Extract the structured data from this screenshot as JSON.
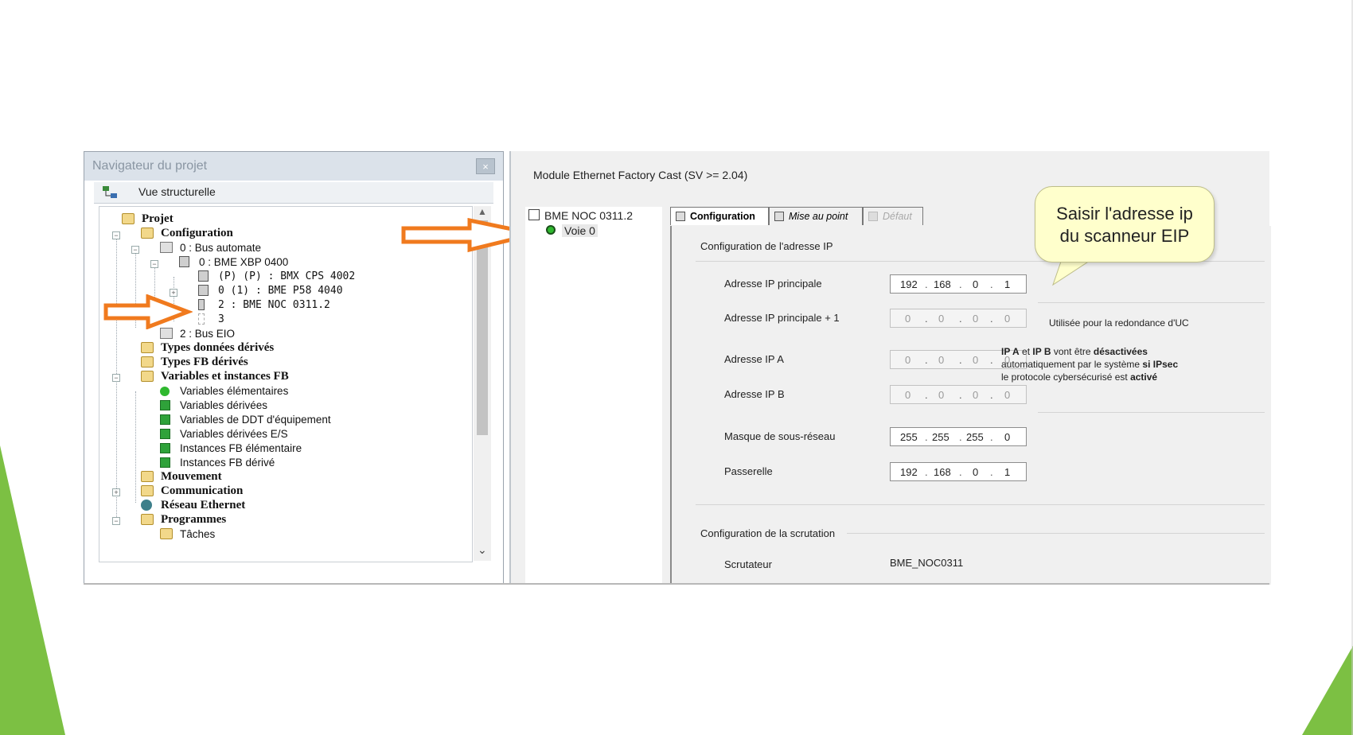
{
  "colors": {
    "arrow": "#f07a1e",
    "accent_green": "#7cc043",
    "callout_bg": "#ffffcc"
  },
  "navigator": {
    "title": "Navigateur du projet",
    "view_label": "Vue structurelle",
    "tree": [
      {
        "label": "Projet"
      },
      {
        "label": "Configuration"
      },
      {
        "label": "0 : Bus automate"
      },
      {
        "label": "0 : BME XBP 0400"
      },
      {
        "label": "(P) (P) : BMX CPS 4002"
      },
      {
        "label": "0 (1) : BME P58 4040"
      },
      {
        "label": "2 : BME NOC 0311.2"
      },
      {
        "label": "3"
      },
      {
        "label": "2 : Bus EIO"
      },
      {
        "label": "Types données dérivés"
      },
      {
        "label": "Types FB dérivés"
      },
      {
        "label": "Variables et instances FB"
      },
      {
        "label": "Variables élémentaires"
      },
      {
        "label": "Variables dérivées"
      },
      {
        "label": "Variables de DDT d'équipement"
      },
      {
        "label": "Variables dérivées E/S"
      },
      {
        "label": "Instances FB élémentaire"
      },
      {
        "label": "Instances FB dérivé"
      },
      {
        "label": "Mouvement"
      },
      {
        "label": "Communication"
      },
      {
        "label": "Réseau Ethernet"
      },
      {
        "label": "Programmes"
      },
      {
        "label": "Tâches"
      }
    ]
  },
  "module": {
    "title": "Module Ethernet Factory Cast (SV >= 2.04)",
    "device": "BME NOC 0311.2",
    "channel": "Voie 0",
    "tabs": [
      {
        "label": "Configuration"
      },
      {
        "label": "Mise au point"
      },
      {
        "label": "Défaut"
      }
    ],
    "ip_section": "Configuration de l'adresse IP",
    "fields": [
      {
        "label": "Adresse IP principale",
        "octets": [
          "192",
          "168",
          "0",
          "1"
        ]
      },
      {
        "label": "Adresse IP principale + 1",
        "octets": [
          "0",
          "0",
          "0",
          "0"
        ]
      },
      {
        "label": "Adresse IP A",
        "octets": [
          "0",
          "0",
          "0",
          "0"
        ]
      },
      {
        "label": "Adresse IP B",
        "octets": [
          "0",
          "0",
          "0",
          "0"
        ]
      },
      {
        "label": "Masque de sous-réseau",
        "octets": [
          "255",
          "255",
          "255",
          "0"
        ]
      },
      {
        "label": "Passerelle",
        "octets": [
          "192",
          "168",
          "0",
          "1"
        ]
      }
    ],
    "redundancy_note": "Utilisée pour la redondance d'UC",
    "ipsec_note": {
      "b1": "IP A",
      "t1": " et ",
      "b2": "IP B",
      "t2": " vont être ",
      "b3": "désactivées",
      "t3": "automatiquement par le système ",
      "b4": "si IPsec",
      "t4": "le protocole cybersécurisé est ",
      "b5": "activé"
    },
    "scan_section": "Configuration de la scrutation",
    "scanner_label": "Scrutateur",
    "scanner_value": "BME_NOC0311"
  },
  "callout": {
    "line1": "Saisir l'adresse ip",
    "line2": "du scanneur EIP"
  }
}
